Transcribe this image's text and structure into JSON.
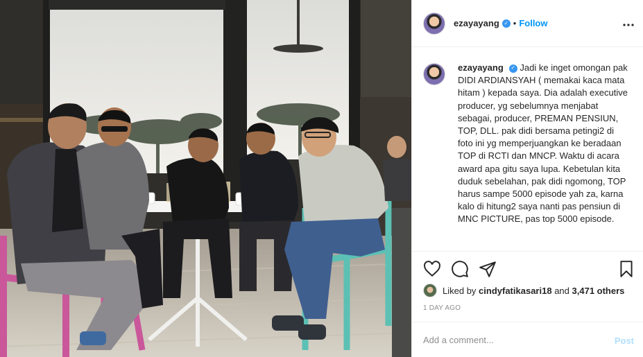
{
  "post": {
    "photo_alt": "Five men seated around a white table by the window",
    "header": {
      "username": "ezayayang",
      "separator": "•",
      "follow_label": "Follow",
      "more_label": "•••"
    },
    "caption": {
      "username": "ezayayang",
      "text": "Jadi ke inget omongan pak DIDI ARDIANSYAH ( memakai kaca mata hitam ) kepada saya. Dia adalah executive producer, yg sebelumnya menjabat sebagai, producer, PREMAN PENSIUN, TOP, DLL. pak didi bersama petingi2 di foto ini yg memperjuangkan ke beradaan TOP di RCTI dan MNCP. Waktu di acara award apa gitu saya lupa. Kebetulan kita duduk sebelahan, pak didi ngomong, TOP harus sampe 5000 episode yah za, karna kalo di hitung2 saya nanti pas pensiun di MNC PICTURE, pas top 5000 episode."
    },
    "actions": {
      "like": "heart-icon",
      "comment": "comment-icon",
      "share": "share-icon",
      "save": "bookmark-icon"
    },
    "likes": {
      "prefix": "Liked by",
      "user": "cindyfatikasari18",
      "middle": "and",
      "others": "3,471 others"
    },
    "timestamp": "1 DAY AGO",
    "comment_box": {
      "placeholder": "Add a comment...",
      "post_label": "Post"
    },
    "colors": {
      "accent": "#0095f6",
      "verified": "#3897f0",
      "post_disabled": "#b2dffc"
    }
  }
}
